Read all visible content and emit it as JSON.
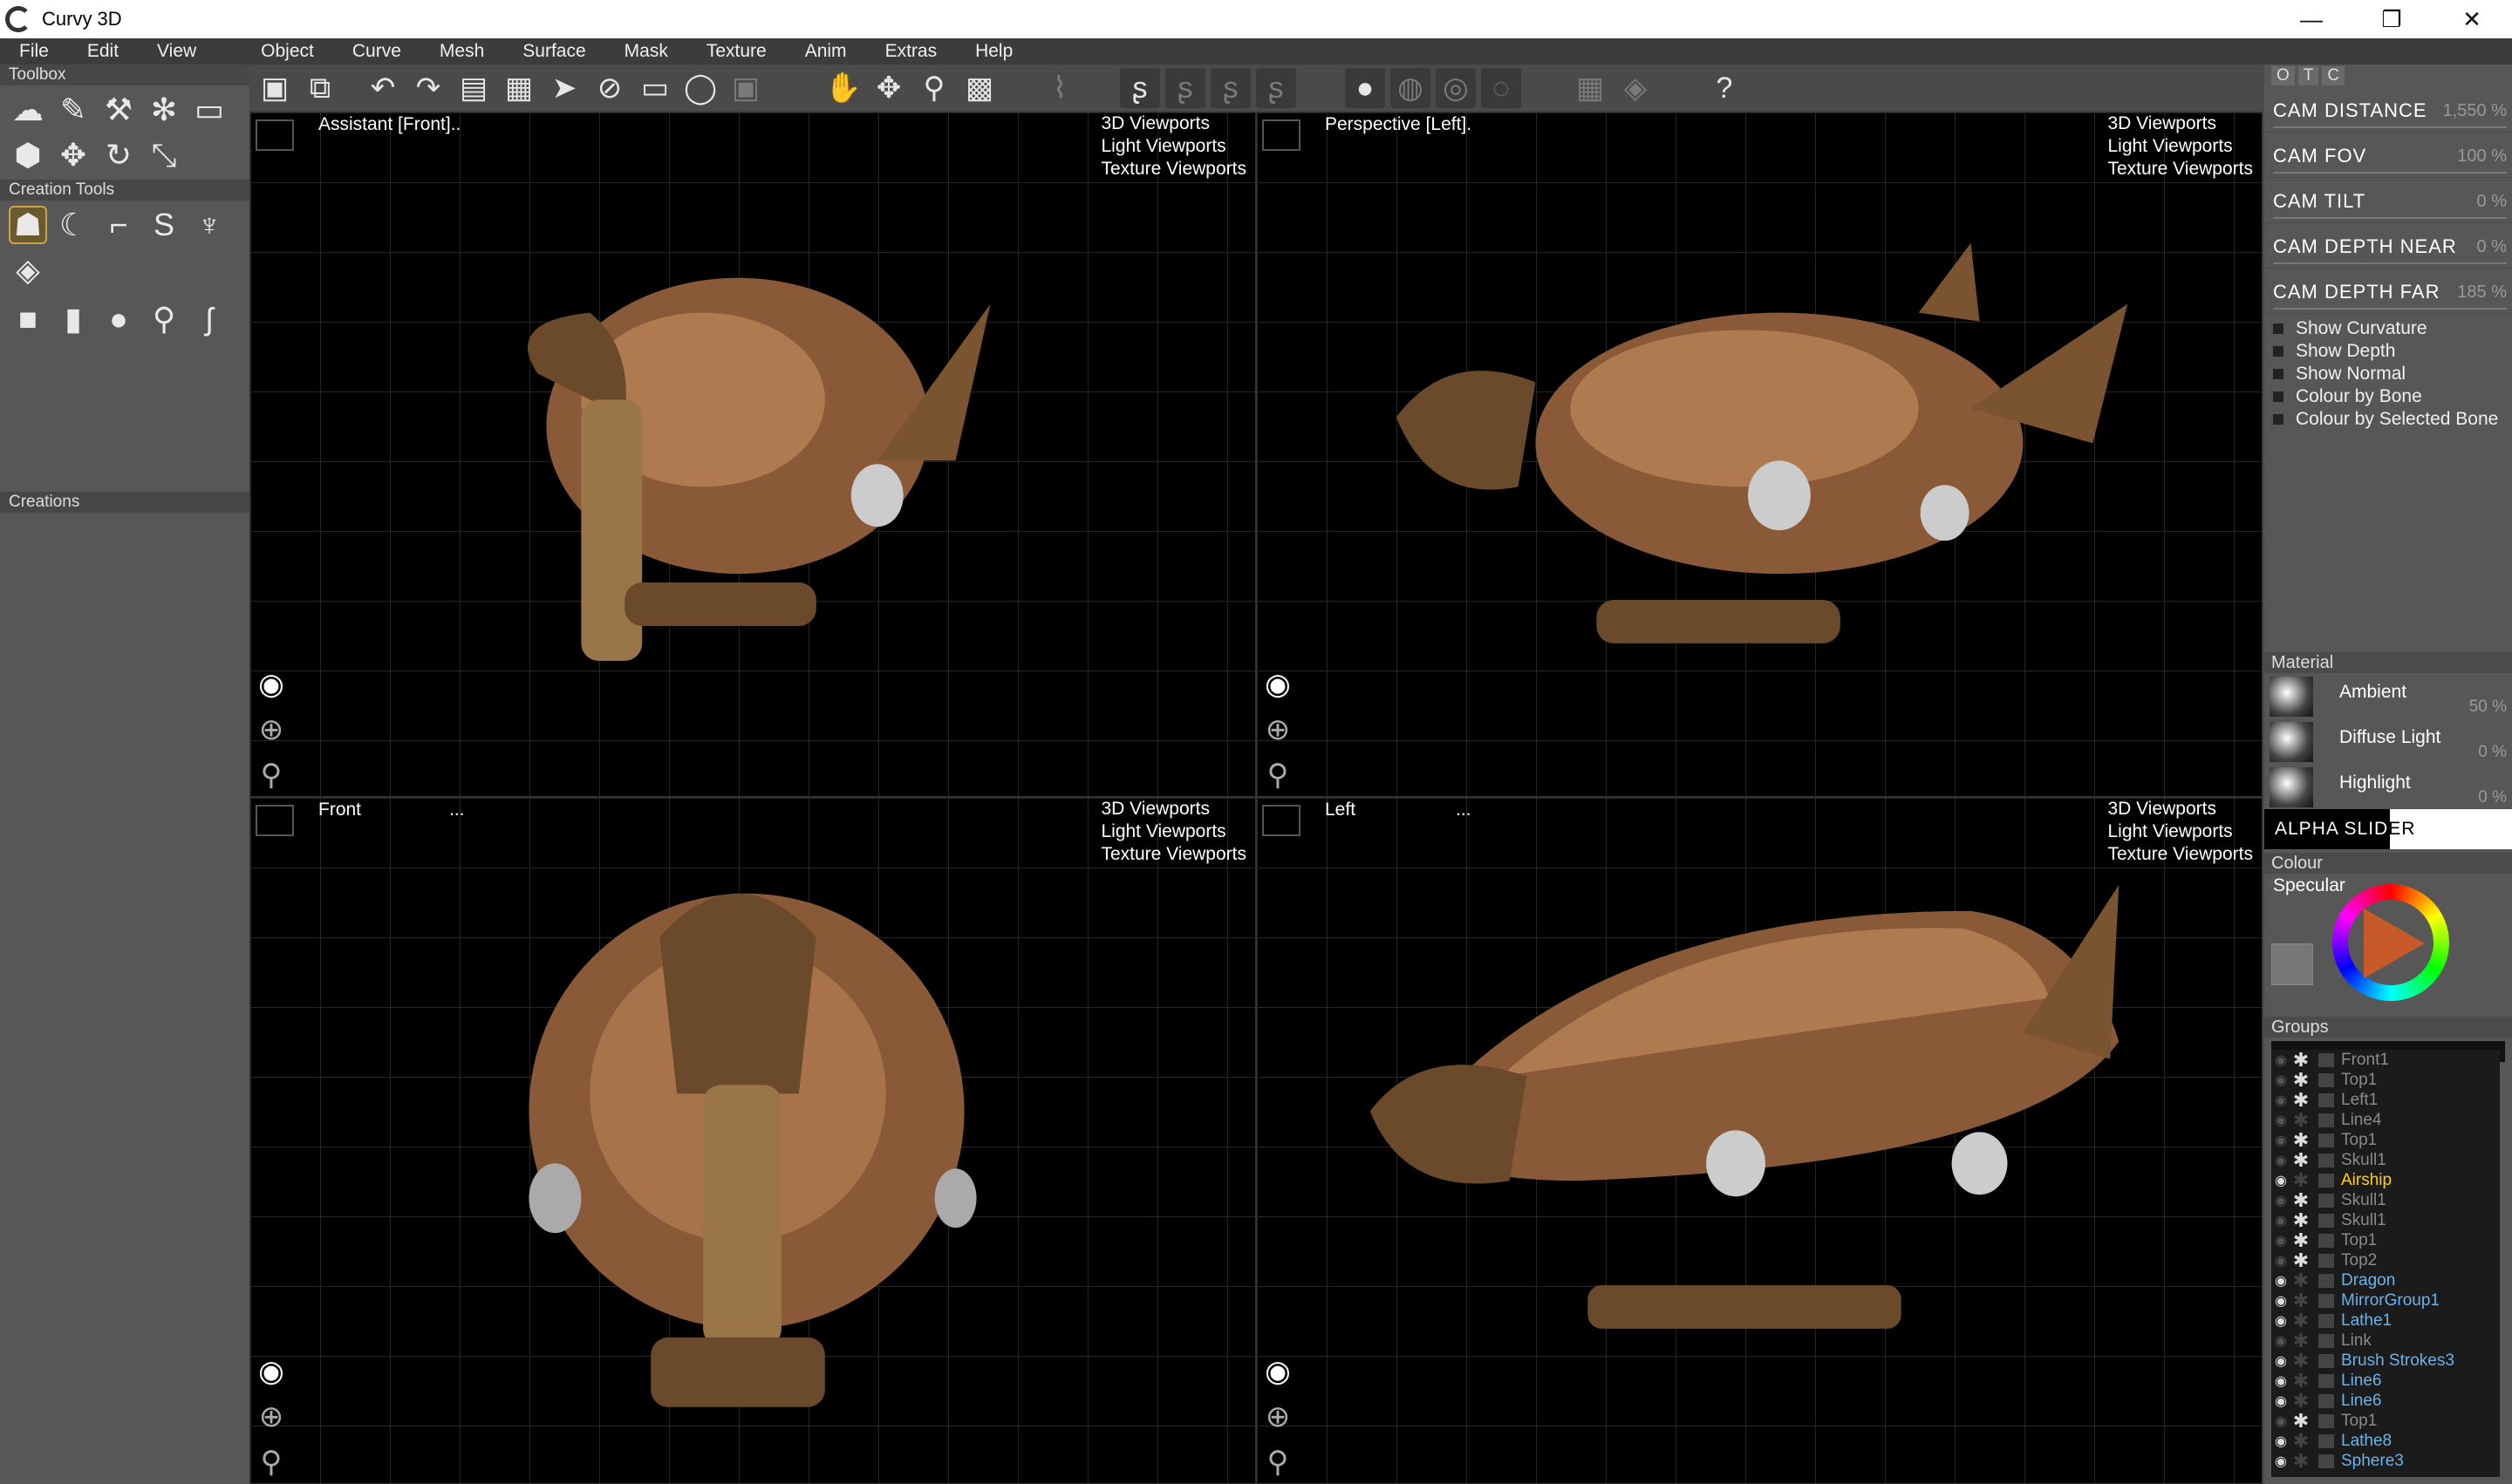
{
  "window": {
    "title": "Curvy 3D",
    "min": "—",
    "max": "❐",
    "close": "✕"
  },
  "menu": [
    "File",
    "Edit",
    "View",
    "Object",
    "Curve",
    "Mesh",
    "Surface",
    "Mask",
    "Texture",
    "Anim",
    "Extras",
    "Help"
  ],
  "left": {
    "toolbox": "Toolbox",
    "creation_tools": "Creation Tools",
    "creations": "Creations"
  },
  "viewports": {
    "tl": {
      "label": "Assistant [Front]..",
      "menu": [
        "3D Viewports",
        "Light Viewports",
        "Texture Viewports"
      ]
    },
    "tr": {
      "label": "Perspective [Left].",
      "menu": [
        "3D Viewports",
        "Light Viewports",
        "Texture Viewports"
      ]
    },
    "bl": {
      "label": "Front",
      "dots": "...",
      "menu": [
        "3D Viewports",
        "Light Viewports",
        "Texture Viewports"
      ]
    },
    "br": {
      "label": "Left",
      "dots": "...",
      "menu": [
        "3D Viewports",
        "Light Viewports",
        "Texture Viewports"
      ]
    }
  },
  "right": {
    "tabs": [
      "O",
      "T",
      "C"
    ],
    "cam": [
      {
        "label": "CAM   DISTANCE",
        "value": "1,550 %"
      },
      {
        "label": "CAM   FOV",
        "value": "100 %"
      },
      {
        "label": "CAM   TILT",
        "value": "0 %"
      },
      {
        "label": "CAM   DEPTH   NEAR",
        "value": "0 %"
      },
      {
        "label": "CAM   DEPTH   FAR",
        "value": "185 %"
      }
    ],
    "checks": [
      "Show Curvature",
      "Show Depth",
      "Show Normal",
      "Colour by Bone",
      "Colour by Selected Bone"
    ],
    "material": "Material",
    "mats": [
      {
        "label": "Ambient",
        "value": "50 %"
      },
      {
        "label": "Diffuse Light",
        "value": "0 %"
      },
      {
        "label": "Highlight",
        "value": "0 %"
      }
    ],
    "alpha": "ALPHA   SLIDER",
    "colour": "Colour",
    "specular": "Specular",
    "groups": "Groups"
  },
  "tree": [
    {
      "name": "Front1",
      "cls": "",
      "eye": false,
      "ast": true
    },
    {
      "name": "Top1",
      "cls": "",
      "eye": false,
      "ast": true
    },
    {
      "name": "Left1",
      "cls": "",
      "eye": false,
      "ast": true
    },
    {
      "name": "Line4",
      "cls": "",
      "eye": false,
      "ast": false
    },
    {
      "name": "Top1",
      "cls": "",
      "eye": false,
      "ast": true
    },
    {
      "name": "Skull1",
      "cls": "",
      "eye": false,
      "ast": true
    },
    {
      "name": "Airship",
      "cls": "yellow",
      "eye": true,
      "ast": false
    },
    {
      "name": "Skull1",
      "cls": "",
      "eye": false,
      "ast": true
    },
    {
      "name": "Skull1",
      "cls": "",
      "eye": false,
      "ast": true
    },
    {
      "name": "Top1",
      "cls": "",
      "eye": false,
      "ast": true
    },
    {
      "name": "Top2",
      "cls": "",
      "eye": false,
      "ast": true
    },
    {
      "name": "Dragon",
      "cls": "blue",
      "eye": true,
      "ast": false
    },
    {
      "name": "MirrorGroup1",
      "cls": "blue",
      "eye": true,
      "ast": false
    },
    {
      "name": "Lathe1",
      "cls": "blue",
      "eye": true,
      "ast": false
    },
    {
      "name": "Link",
      "cls": "",
      "eye": false,
      "ast": false
    },
    {
      "name": "Brush Strokes3",
      "cls": "blue",
      "eye": true,
      "ast": false
    },
    {
      "name": "Line6",
      "cls": "blue",
      "eye": true,
      "ast": false
    },
    {
      "name": "Line6",
      "cls": "blue",
      "eye": true,
      "ast": false
    },
    {
      "name": "Top1",
      "cls": "",
      "eye": false,
      "ast": true
    },
    {
      "name": "Lathe8",
      "cls": "blue",
      "eye": true,
      "ast": false
    },
    {
      "name": "Sphere3",
      "cls": "blue",
      "eye": true,
      "ast": false
    }
  ]
}
